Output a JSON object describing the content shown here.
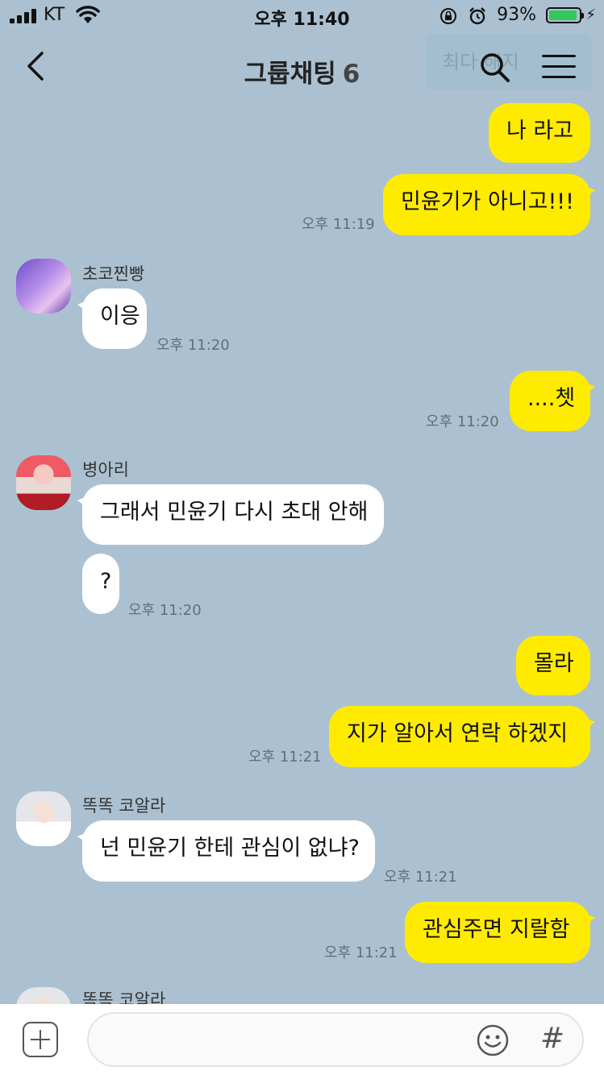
{
  "status_bar": {
    "carrier": "KT",
    "time": "오후 11:40",
    "battery_percent": "93%",
    "battery_level": 0.93
  },
  "header": {
    "title": "그룹채팅",
    "member_count": "6"
  },
  "notice_text": "최다 해지",
  "messages": {
    "m1": "나 라고",
    "m2": "민윤기가 아니고!!!",
    "m2_time": "오후 11:19",
    "s1_name": "초코찐빵",
    "m3": "이응",
    "m3_time": "오후 11:20",
    "m4": "....쳇",
    "m4_time": "오후 11:20",
    "s2_name": "병아리",
    "m5": "그래서 민윤기 다시 초대 안해",
    "m6": "?",
    "m6_time": "오후 11:20",
    "m7": "몰라",
    "m8": "지가 알아서 연락 하겠지",
    "m8_time": "오후 11:21",
    "s3_name": "똑똑 코알라",
    "m9": "넌 민윤기 한테 관심이 없냐?",
    "m9_time": "오후 11:21",
    "m10": "관심주면 지랄함",
    "m10_time": "오후 11:21",
    "s4_name": "똑똑 코알라"
  },
  "colors": {
    "background": "#abc1d1",
    "my_bubble": "#ffeb00",
    "their_bubble": "#ffffff"
  }
}
